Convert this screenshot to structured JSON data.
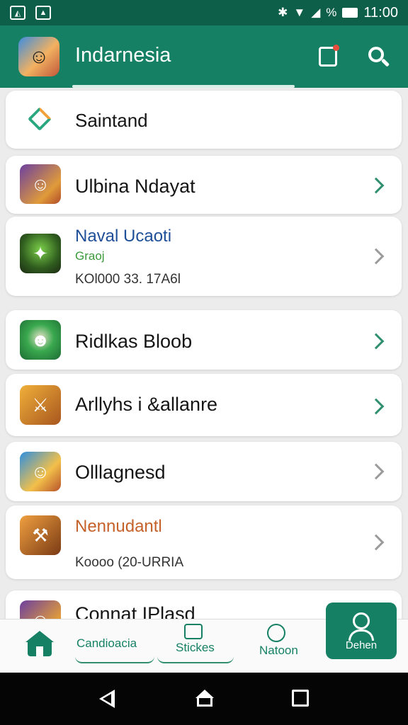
{
  "status_bar": {
    "time": "11:00",
    "left_icons": [
      "photo-icon",
      "gallery-icon"
    ],
    "right_icons": [
      "bluetooth-icon",
      "wifi-icon",
      "signal-icon",
      "battery-icon"
    ],
    "battery_text": "%"
  },
  "app_bar": {
    "title": "Indarnesia",
    "actions": [
      "notification-icon",
      "search-icon"
    ]
  },
  "search_row": {
    "label": "Saintand"
  },
  "items": [
    {
      "title": "Ulbina Ndayat",
      "chevron_color": "#2f8f6f"
    },
    {
      "title": "Naval Ucaoti",
      "line2": "Graoj",
      "line3": "KOl000 33. 17A6l",
      "chevron_color": "#9b9b9b"
    },
    {
      "title": "Ridlkas Bloob",
      "chevron_color": "#2f8f6f"
    },
    {
      "title": "Arllyhs i &allanre",
      "chevron_color": "#2f8f6f"
    },
    {
      "title": "Olllagnesd",
      "chevron_color": "#9b9b9b"
    },
    {
      "title": "Nennudantl",
      "line3": "Koooo (20-URRIA",
      "chevron_color": "#9b9b9b"
    },
    {
      "title": "Connat IPlasd"
    }
  ],
  "bottom_nav": {
    "tabs": [
      {
        "label": "Candioacia"
      },
      {
        "label": "Stickes"
      },
      {
        "label": "Natoon"
      }
    ],
    "profile_label": "Dehen"
  },
  "colors": {
    "brand": "#168064",
    "status_bar": "#0d5f49",
    "accent_blue": "#1f4f98",
    "accent_green": "#3a9a3a",
    "accent_orange": "#c5612a"
  }
}
